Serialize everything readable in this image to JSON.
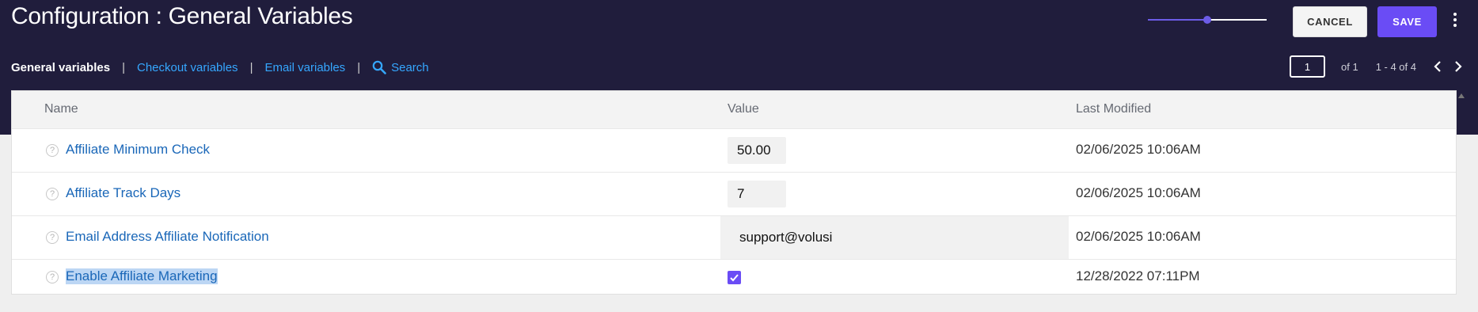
{
  "header": {
    "title": "Configuration : General Variables",
    "slider_value": 0.5,
    "cancel_label": "CANCEL",
    "save_label": "SAVE",
    "more_icon": "more-vertical-icon"
  },
  "tabs": [
    {
      "label": "General variables",
      "active": true
    },
    {
      "label": "Checkout variables",
      "active": false
    },
    {
      "label": "Email variables",
      "active": false
    }
  ],
  "search": {
    "label": "Search",
    "icon": "search-icon"
  },
  "pagination": {
    "page": "1",
    "of_label": "of 1",
    "range_label": "1 - 4 of 4"
  },
  "table": {
    "columns": [
      "Name",
      "Value",
      "Last Modified"
    ],
    "rows": [
      {
        "name": "Affiliate Minimum Check",
        "value": "50.00",
        "modified": "02/06/2025 10:06AM"
      },
      {
        "name": "Affiliate Track Days",
        "value": "7",
        "modified": "02/06/2025 10:06AM"
      },
      {
        "name": "Email Address Affiliate Notification",
        "value": "support@volusi",
        "modified": "02/06/2025 10:06AM"
      },
      {
        "name": "Enable Affiliate Marketing",
        "value_checked": true,
        "modified": "12/28/2022 07:11PM"
      }
    ]
  },
  "colors": {
    "header_bg": "#201d3c",
    "accent": "#6a4cf5",
    "link": "#35a7ff",
    "row_link": "#1a67b8"
  }
}
